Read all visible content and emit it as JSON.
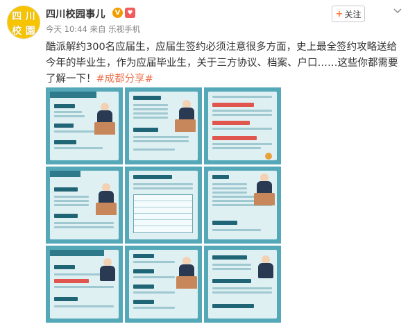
{
  "account": {
    "name": "四川校园事儿",
    "avatar_chars": [
      "四",
      "川",
      "校",
      "園"
    ],
    "verified_color": "#f29c00",
    "rank_label": "♥"
  },
  "meta": {
    "time": "今天 10:44",
    "source_prefix": "来自",
    "source": "乐视手机"
  },
  "follow": {
    "label": "关注",
    "plus": "+"
  },
  "more_icon": "chevron-down-icon",
  "post": {
    "text": "酷派解约300名应届生，应届生签约必须注意很多方面，史上最全签约攻略送给今年的毕业生，作为应届毕业生，关于三方协议、档案、户口……这些你都需要了解一下！",
    "hashtag": "#成都分享#"
  },
  "colors": {
    "accent": "#eb7350",
    "tile_bg": "#54a8b8",
    "text": "#333333",
    "meta": "#808080"
  },
  "photos": [
    {
      "label": "photo-1"
    },
    {
      "label": "photo-2"
    },
    {
      "label": "photo-3"
    },
    {
      "label": "photo-4"
    },
    {
      "label": "photo-5"
    },
    {
      "label": "photo-6"
    },
    {
      "label": "photo-7"
    },
    {
      "label": "photo-8"
    },
    {
      "label": "photo-9"
    }
  ]
}
